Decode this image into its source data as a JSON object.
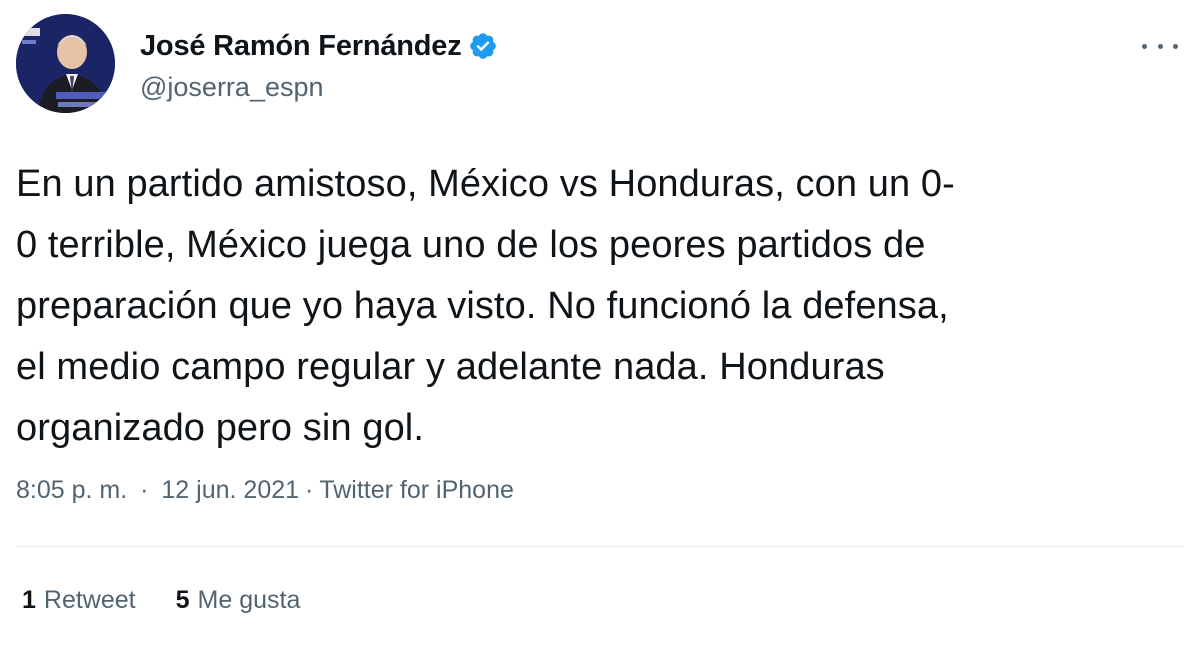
{
  "user": {
    "name": "José Ramón Fernández",
    "handle": "@joserra_espn",
    "verified": true,
    "avatar_icon": "profile-photo",
    "verified_icon": "verified-badge-icon",
    "verified_color": "#1d9bf0"
  },
  "tweet": {
    "text": "En un partido amistoso, México vs Honduras, con un 0-\n0 terrible, México juega uno de los peores partidos de\npreparación que yo haya visto. No funcionó la defensa,\nel medio campo regular y adelante nada. Honduras\norganizado pero sin gol.",
    "time": "8:05 p. m.",
    "separator": "·",
    "date": "12 jun. 2021",
    "source": "Twitter for iPhone"
  },
  "stats": {
    "retweets_count": "1",
    "retweets_label": "Retweet",
    "likes_count": "5",
    "likes_label": "Me gusta"
  },
  "more_icon": "more-options-icon",
  "colors": {
    "text_primary": "#0f1419",
    "text_secondary": "#536471",
    "divider": "#e6ecf0"
  }
}
